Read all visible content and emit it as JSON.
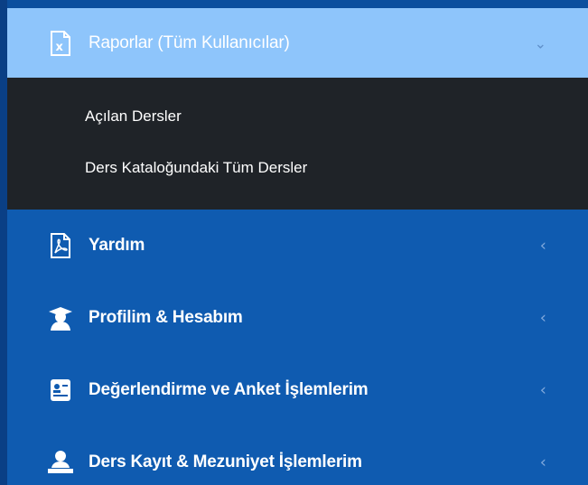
{
  "menu": {
    "items": [
      {
        "label": "Raporlar (Tüm Kullanıcılar)",
        "icon": "excel-file-icon",
        "expanded": true
      },
      {
        "label": "Yardım",
        "icon": "pdf-file-icon",
        "expanded": false
      },
      {
        "label": "Profilim & Hesabım",
        "icon": "graduate-user-icon",
        "expanded": false
      },
      {
        "label": "Değerlendirme ve Anket İşlemlerim",
        "icon": "id-card-icon",
        "expanded": false
      },
      {
        "label": "Ders Kayıt & Mezuniyet İşlemlerim",
        "icon": "user-desk-icon",
        "expanded": false
      }
    ],
    "submenu": [
      {
        "label": "Açılan Dersler"
      },
      {
        "label": "Ders Kataloğundaki Tüm Dersler"
      }
    ],
    "chevron_expanded": "⌄",
    "chevron_collapsed": "‹"
  },
  "colors": {
    "sidebar_bg": "#0f5bb0",
    "active_bg": "#8ec5fb",
    "submenu_bg": "#1f2328",
    "text": "#ffffff"
  }
}
